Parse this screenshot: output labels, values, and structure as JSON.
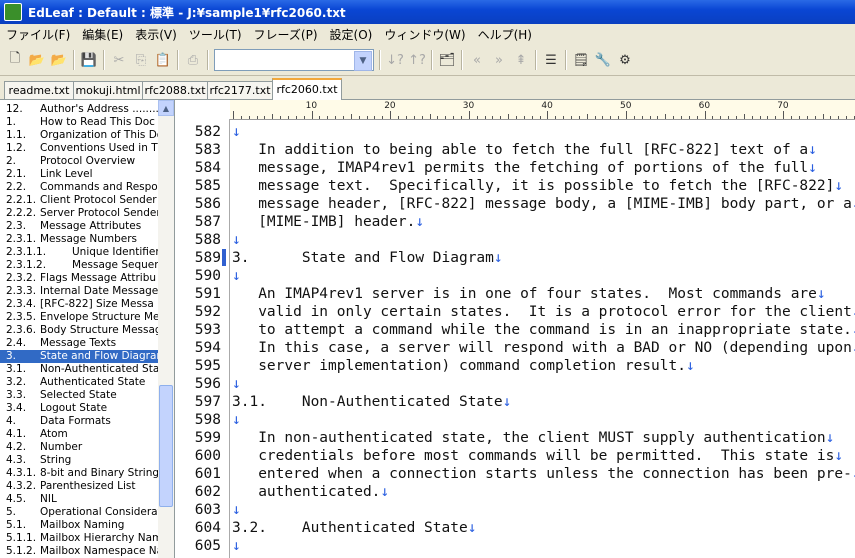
{
  "window": {
    "title": "EdLeaf : Default : 標準 - J:¥sample1¥rfc2060.txt"
  },
  "menu": [
    "ファイル(F)",
    "編集(E)",
    "表示(V)",
    "ツール(T)",
    "フレーズ(P)",
    "設定(O)",
    "ウィンドウ(W)",
    "ヘルプ(H)"
  ],
  "toolbar": {
    "search_value": ""
  },
  "tabs": [
    "readme.txt",
    "mokuji.html",
    "rfc2088.txt",
    "rfc2177.txt",
    "rfc2060.txt"
  ],
  "active_tab": "rfc2060.txt",
  "outline": [
    {
      "num": "12.",
      "text": "Author's Address ........"
    },
    {
      "num": "1.",
      "text": "How to Read This Doc"
    },
    {
      "num": "1.1.",
      "text": "Organization of This Do"
    },
    {
      "num": "1.2.",
      "text": "Conventions Used in T"
    },
    {
      "num": "2.",
      "text": "Protocol Overview"
    },
    {
      "num": "2.1.",
      "text": "Link Level"
    },
    {
      "num": "2.2.",
      "text": "Commands and Respor"
    },
    {
      "num": "2.2.1.",
      "text": "Client Protocol Sender"
    },
    {
      "num": "2.2.2.",
      "text": "Server Protocol Sender"
    },
    {
      "num": "2.3.",
      "text": "Message Attributes"
    },
    {
      "num": "2.3.1.",
      "text": "Message Numbers"
    },
    {
      "num": "2.3.1.1.",
      "text": "Unique Identifier"
    },
    {
      "num": "2.3.1.2.",
      "text": "Message Sequen"
    },
    {
      "num": "2.3.2.",
      "text": "Flags Message Attribu"
    },
    {
      "num": "2.3.3.",
      "text": "Internal Date Message"
    },
    {
      "num": "2.3.4.",
      "text": "[RFC-822] Size Messa"
    },
    {
      "num": "2.3.5.",
      "text": "Envelope Structure Me"
    },
    {
      "num": "2.3.6.",
      "text": "Body Structure Messag"
    },
    {
      "num": "2.4.",
      "text": "Message Texts"
    },
    {
      "num": "3.",
      "text": "State and Flow Diagrar"
    },
    {
      "num": "3.1.",
      "text": "Non-Authenticated Sta"
    },
    {
      "num": "3.2.",
      "text": "Authenticated State"
    },
    {
      "num": "3.3.",
      "text": "Selected State"
    },
    {
      "num": "3.4.",
      "text": "Logout State"
    },
    {
      "num": "4.",
      "text": "Data Formats"
    },
    {
      "num": "4.1.",
      "text": "Atom"
    },
    {
      "num": "4.2.",
      "text": "Number"
    },
    {
      "num": "4.3.",
      "text": "String"
    },
    {
      "num": "4.3.1.",
      "text": "8-bit and Binary String"
    },
    {
      "num": "4.3.2.",
      "text": "Parenthesized List"
    },
    {
      "num": "4.5.",
      "text": "NIL"
    },
    {
      "num": "5.",
      "text": "Operational Considerat"
    },
    {
      "num": "5.1.",
      "text": "Mailbox Naming"
    },
    {
      "num": "5.1.1.",
      "text": "Mailbox Hierarchy Nam"
    },
    {
      "num": "5.1.2.",
      "text": "Mailbox Namespace Na"
    }
  ],
  "outline_selected": "State and Flow Diagrar",
  "ruler_labels": [
    "10",
    "20",
    "30",
    "40",
    "50",
    "60",
    "70"
  ],
  "eol_glyph": "↓",
  "lines": [
    {
      "n": "582",
      "t": ""
    },
    {
      "n": "583",
      "t": "   In addition to being able to fetch the full [RFC-822] text of a"
    },
    {
      "n": "584",
      "t": "   message, IMAP4rev1 permits the fetching of portions of the full"
    },
    {
      "n": "585",
      "t": "   message text.  Specifically, it is possible to fetch the [RFC-822]"
    },
    {
      "n": "586",
      "t": "   message header, [RFC-822] message body, a [MIME-IMB] body part, or a"
    },
    {
      "n": "587",
      "t": "   [MIME-IMB] header."
    },
    {
      "n": "588",
      "t": ""
    },
    {
      "n": "589",
      "t": "3.      State and Flow Diagram"
    },
    {
      "n": "590",
      "t": ""
    },
    {
      "n": "591",
      "t": "   An IMAP4rev1 server is in one of four states.  Most commands are"
    },
    {
      "n": "592",
      "t": "   valid in only certain states.  It is a protocol error for the client"
    },
    {
      "n": "593",
      "t": "   to attempt a command while the command is in an inappropriate state."
    },
    {
      "n": "594",
      "t": "   In this case, a server will respond with a BAD or NO (depending upon"
    },
    {
      "n": "595",
      "t": "   server implementation) command completion result."
    },
    {
      "n": "596",
      "t": ""
    },
    {
      "n": "597",
      "t": "3.1.    Non-Authenticated State"
    },
    {
      "n": "598",
      "t": ""
    },
    {
      "n": "599",
      "t": "   In non-authenticated state, the client MUST supply authentication"
    },
    {
      "n": "600",
      "t": "   credentials before most commands will be permitted.  This state is"
    },
    {
      "n": "601",
      "t": "   entered when a connection starts unless the connection has been pre-"
    },
    {
      "n": "602",
      "t": "   authenticated."
    },
    {
      "n": "603",
      "t": ""
    },
    {
      "n": "604",
      "t": "3.2.    Authenticated State"
    },
    {
      "n": "605",
      "t": ""
    }
  ],
  "cursor_line": "589"
}
